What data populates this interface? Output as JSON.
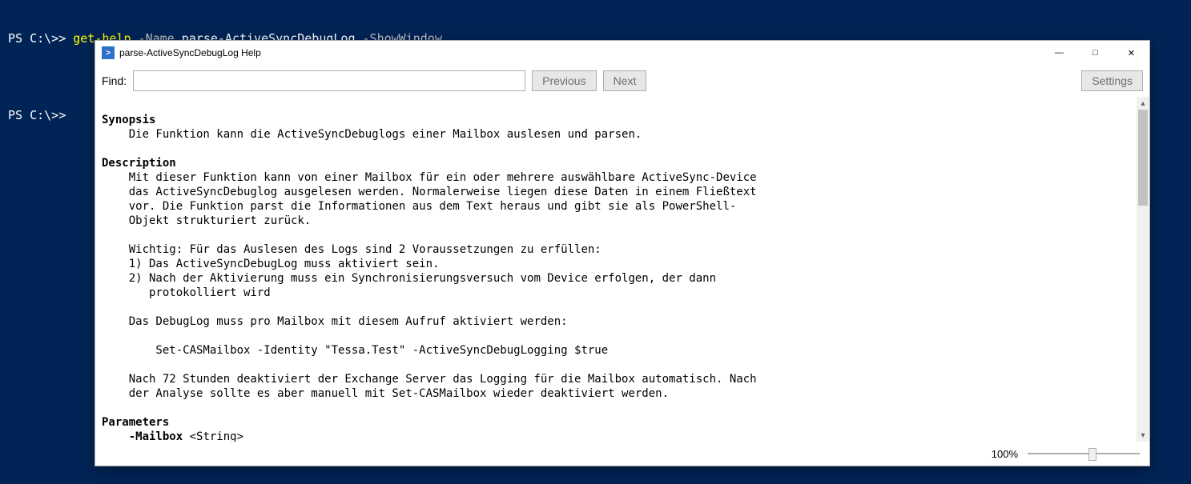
{
  "console": {
    "prompt": "PS C:\\>> ",
    "cmd_name": "get-help",
    "arg1_flag": "-Name",
    "arg1_val": "parse-ActiveSyncDebugLog",
    "arg2_flag": "-ShowWindow",
    "prompt2": "PS C:\\>>"
  },
  "window": {
    "icon_char": ">",
    "title": "parse-ActiveSyncDebugLog Help",
    "minimize": "—",
    "maximize": "□",
    "close": "✕"
  },
  "toolbar": {
    "find_label": "Find:",
    "find_value": "",
    "prev_label": "Previous",
    "next_label": "Next",
    "settings_label": "Settings"
  },
  "help": {
    "synopsis_h": "Synopsis",
    "synopsis_txt": "    Die Funktion kann die ActiveSyncDebuglogs einer Mailbox auslesen und parsen.",
    "description_h": "Description",
    "d1": "    Mit dieser Funktion kann von einer Mailbox für ein oder mehrere auswählbare ActiveSync-Device",
    "d2": "    das ActiveSyncDebuglog ausgelesen werden. Normalerweise liegen diese Daten in einem Fließtext",
    "d3": "    vor. Die Funktion parst die Informationen aus dem Text heraus und gibt sie als PowerShell-",
    "d4": "    Objekt strukturiert zurück.",
    "d5": "    Wichtig: Für das Auslesen des Logs sind 2 Voraussetzungen zu erfüllen:",
    "d6": "    1) Das ActiveSyncDebugLog muss aktiviert sein.",
    "d7": "    2) Nach der Aktivierung muss ein Synchronisierungsversuch vom Device erfolgen, der dann",
    "d8": "       protokolliert wird",
    "d9": "    Das DebugLog muss pro Mailbox mit diesem Aufruf aktiviert werden:",
    "d10": "        Set-CASMailbox -Identity \"Tessa.Test\" -ActiveSyncDebugLogging $true",
    "d11": "    Nach 72 Stunden deaktiviert der Exchange Server das Logging für die Mailbox automatisch. Nach",
    "d12": "    der Analyse sollte es aber manuell mit Set-CASMailbox wieder deaktiviert werden.",
    "parameters_h": "Parameters",
    "param1": "    -Mailbox",
    "param1_type": " <String>"
  },
  "status": {
    "zoom": "100%"
  }
}
